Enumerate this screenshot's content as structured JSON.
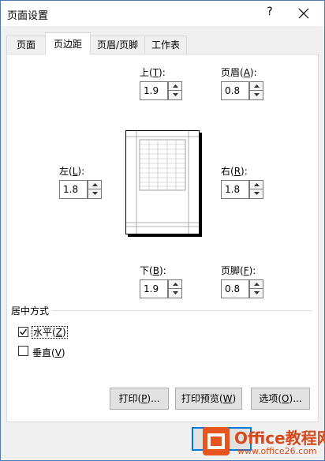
{
  "window": {
    "title": "页面设置",
    "help": "?"
  },
  "tabs": [
    {
      "label": "页面",
      "active": false
    },
    {
      "label": "页边距",
      "active": true
    },
    {
      "label": "页眉/页脚",
      "active": false
    },
    {
      "label": "工作表",
      "active": false
    }
  ],
  "margins": {
    "top": {
      "label": "上",
      "key": "T",
      "value": "1.9"
    },
    "header": {
      "label": "页眉",
      "key": "A",
      "value": "0.8"
    },
    "left": {
      "label": "左",
      "key": "L",
      "value": "1.8"
    },
    "right": {
      "label": "右",
      "key": "R",
      "value": "1.8"
    },
    "bottom": {
      "label": "下",
      "key": "B",
      "value": "1.9"
    },
    "footer": {
      "label": "页脚",
      "key": "F",
      "value": "0.8"
    }
  },
  "center": {
    "group_label": "居中方式",
    "horizontal": {
      "label": "水平",
      "key": "Z",
      "checked": true
    },
    "vertical": {
      "label": "垂直",
      "key": "V",
      "checked": false
    }
  },
  "buttons": {
    "print": {
      "label": "打印",
      "key": "P",
      "suffix": "..."
    },
    "preview": {
      "label": "打印预览",
      "key": "W",
      "suffix": ""
    },
    "options": {
      "label": "选项",
      "key": "O",
      "suffix": "..."
    }
  },
  "watermark": {
    "brand": "Office教程网",
    "url": "www.office26.com"
  },
  "colors": {
    "accent": "#0078d7",
    "watermark": "#d44a1c"
  }
}
